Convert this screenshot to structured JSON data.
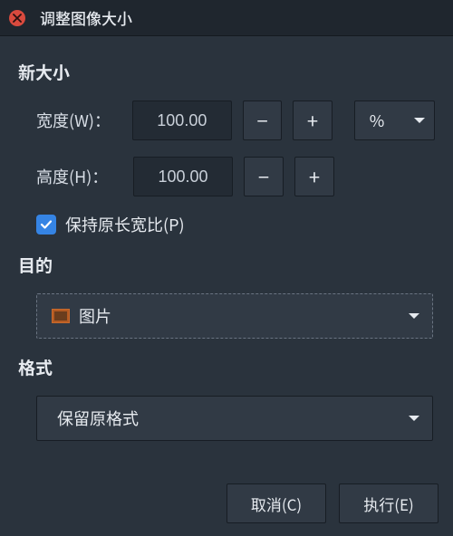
{
  "title": "调整图像大小",
  "sections": {
    "new_size": {
      "heading": "新大小",
      "width_label": "宽度(W)：",
      "height_label": "高度(H)：",
      "width_value": "100.00",
      "height_value": "100.00",
      "minus": "−",
      "plus": "+",
      "unit": "%",
      "aspect_checked": true,
      "aspect_label": "保持原长宽比(P)"
    },
    "target": {
      "heading": "目的",
      "selected": "图片"
    },
    "format": {
      "heading": "格式",
      "selected": "保留原格式"
    }
  },
  "buttons": {
    "cancel": "取消(C)",
    "execute": "执行(E)"
  }
}
